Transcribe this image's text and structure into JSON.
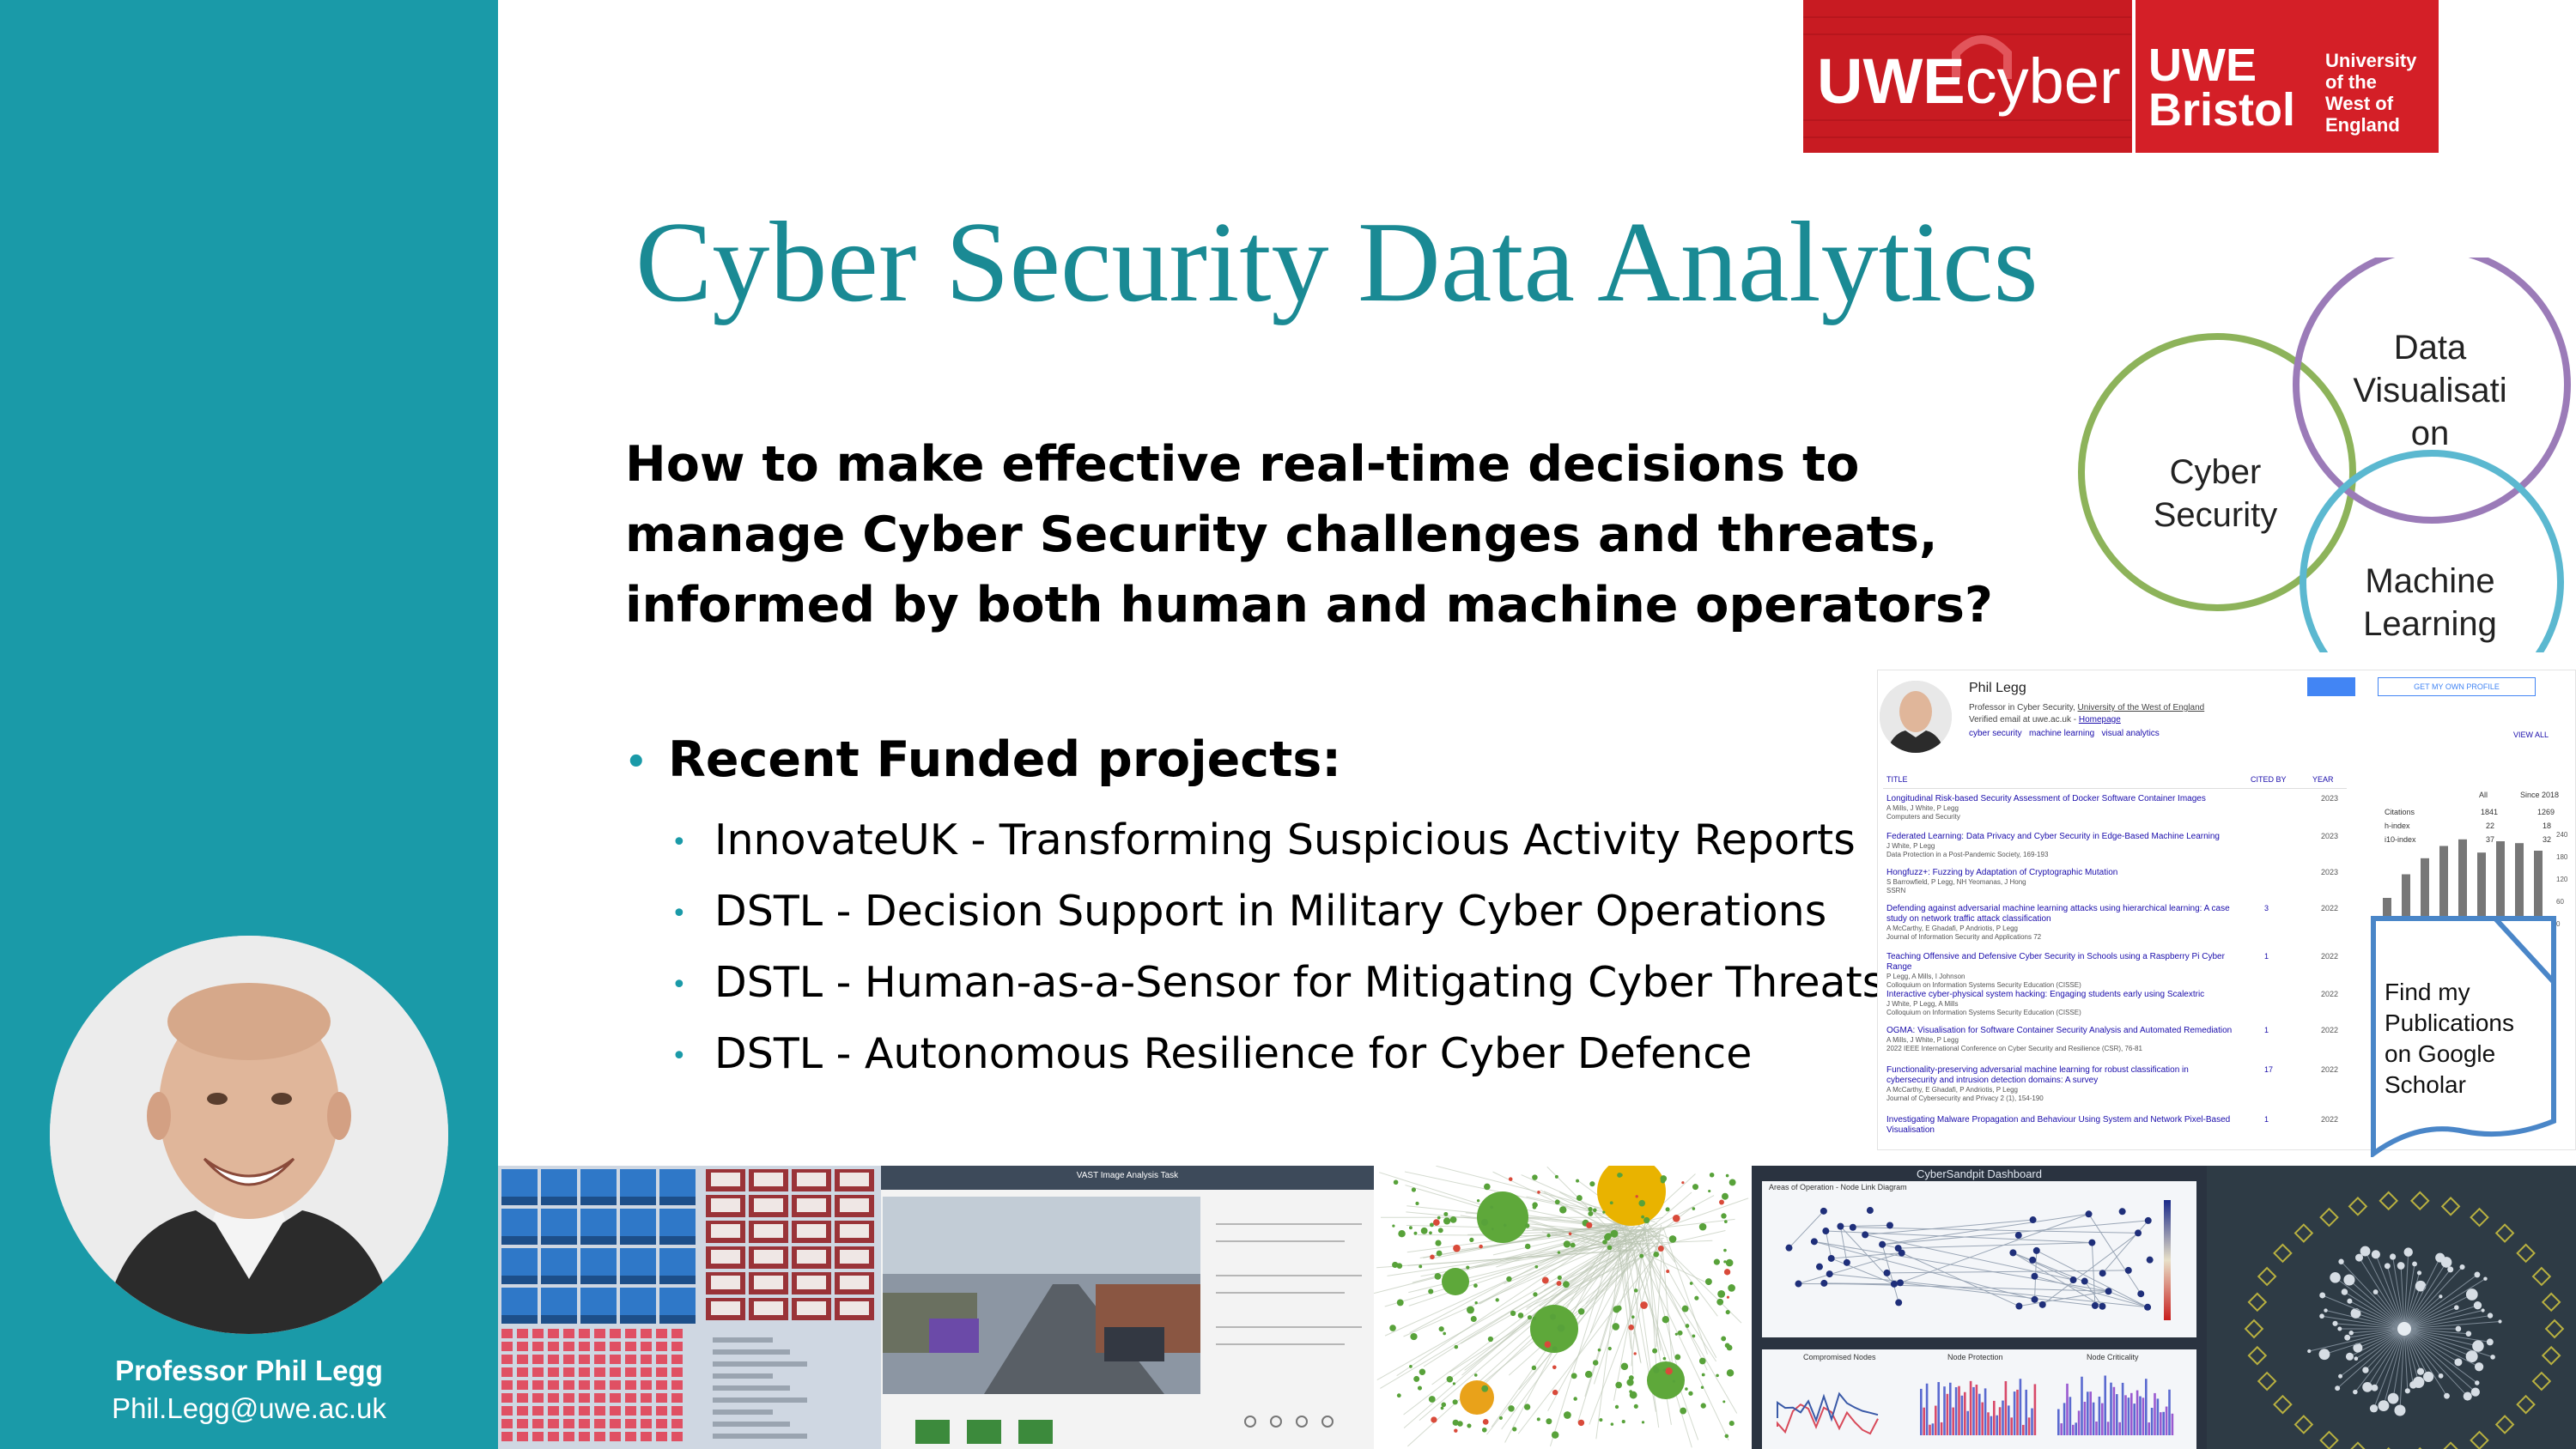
{
  "logo": {
    "cyber_bold": "UWE",
    "cyber_rest": "cyber",
    "uwe_line1": "UWE",
    "uwe_line2": "Bristol",
    "univ_line1": "University",
    "univ_line2": "of the",
    "univ_line3": "West of",
    "univ_line4": "England"
  },
  "title": "Cyber Security Data Analytics",
  "question": {
    "line1": "How to make effective real-time decisions to",
    "line2": "manage Cyber Security challenges and threats,",
    "line3": "informed by both human and machine operators?"
  },
  "projects": {
    "heading": "Recent Funded projects:",
    "items": [
      "InnovateUK - Transforming Suspicious Activity Reports",
      "DSTL - Decision Support in Military Cyber Operations",
      "DSTL - Human-as-a-Sensor for Mitigating Cyber Threats",
      "DSTL - Autonomous Resilience for Cyber Defence"
    ]
  },
  "venn": {
    "cyber_line1": "Cyber",
    "cyber_line2": "Security",
    "vis_line1": "Data",
    "vis_line2": "Visualisati",
    "vis_line3": "on",
    "ml_line1": "Machine",
    "ml_line2": "Learning",
    "colors": {
      "cyber": "#8db35a",
      "vis": "#9b7bb8",
      "ml": "#5bb8d0"
    }
  },
  "profile": {
    "name": "Professor Phil Legg",
    "email": "Phil.Legg@uwe.ac.uk"
  },
  "scholar": {
    "name": "Phil Legg",
    "affiliation_prefix": "Professor in Cyber Security,",
    "affiliation_link": "University of the West of England",
    "email_line": "Verified email at uwe.ac.uk -",
    "homepage": "Homepage",
    "tags": [
      "cyber security",
      "machine learning",
      "visual analytics"
    ],
    "get_profile": "GET MY OWN PROFILE",
    "col_title": "TITLE",
    "col_cited": "CITED BY",
    "col_year": "YEAR",
    "stats_all": "All",
    "stats_since": "Since 2018",
    "view_all": "VIEW ALL",
    "stats": [
      {
        "label": "Citations",
        "all": "1841",
        "since": "1269"
      },
      {
        "label": "h-index",
        "all": "22",
        "since": "18"
      },
      {
        "label": "i10-index",
        "all": "37",
        "since": "32"
      }
    ],
    "axis_ticks": [
      "240",
      "180",
      "120",
      "60",
      "0"
    ],
    "bar_values": [
      0.3,
      0.55,
      0.72,
      0.85,
      0.92,
      0.78,
      0.9,
      0.88,
      0.8
    ],
    "publications": [
      {
        "title": "Longitudinal Risk-based Security Assessment of Docker Software Container Images",
        "authors": "A Mills, J White, P Legg",
        "venue": "Computers and Security",
        "cited": "",
        "year": "2023"
      },
      {
        "title": "Federated Learning: Data Privacy and Cyber Security in Edge-Based Machine Learning",
        "authors": "J White, P Legg",
        "venue": "Data Protection in a Post-Pandemic Society, 169-193",
        "cited": "",
        "year": "2023"
      },
      {
        "title": "Hongfuzz+: Fuzzing by Adaptation of Cryptographic Mutation",
        "authors": "S Barrowfield, P Legg, NH Yeomanas, J Hong",
        "venue": "SSRN",
        "cited": "",
        "year": "2023"
      },
      {
        "title": "Defending against adversarial machine learning attacks using hierarchical learning: A case study on network traffic attack classification",
        "authors": "A McCarthy, E Ghadafi, P Andriotis, P Legg",
        "venue": "Journal of Information Security and Applications 72",
        "cited": "3",
        "year": "2022"
      },
      {
        "title": "Teaching Offensive and Defensive Cyber Security in Schools using a Raspberry Pi Cyber Range",
        "authors": "P Legg, A Mills, I Johnson",
        "venue": "Colloquium on Information Systems Security Education (CISSE)",
        "cited": "1",
        "year": "2022"
      },
      {
        "title": "Interactive cyber-physical system hacking: Engaging students early using Scalextric",
        "authors": "J White, P Legg, A Mills",
        "venue": "Colloquium on Information Systems Security Education (CISSE)",
        "cited": "",
        "year": "2022"
      },
      {
        "title": "OGMA: Visualisation for Software Container Security Analysis and Automated Remediation",
        "authors": "A Mills, J White, P Legg",
        "venue": "2022 IEEE International Conference on Cyber Security and Resilience (CSR), 76-81",
        "cited": "1",
        "year": "2022"
      },
      {
        "title": "Functionality-preserving adversarial machine learning for robust classification in cybersecurity and intrusion detection domains: A survey",
        "authors": "A McCarthy, E Ghadafi, P Andriotis, P Legg",
        "venue": "Journal of Cybersecurity and Privacy 2 (1), 154-190",
        "cited": "17",
        "year": "2022"
      },
      {
        "title": "Investigating Malware Propagation and Behaviour Using System and Network Pixel-Based Visualisation",
        "authors": "",
        "venue": "",
        "cited": "1",
        "year": "2022"
      }
    ]
  },
  "callout": {
    "line1": "Find my",
    "line2": "Publications",
    "line3": "on Google",
    "line4": "Scholar"
  },
  "strip": {
    "image_task_title": "VAST Image Analysis Task",
    "dashboard_title": "CyberSandpit Dashboard",
    "dashboard_chart_title": "Areas of Operation - Node Link Diagram",
    "panel1": "Compromised Nodes",
    "panel2": "Node Protection",
    "panel3": "Node Criticality"
  }
}
